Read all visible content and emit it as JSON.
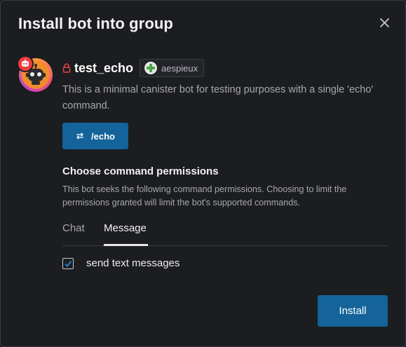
{
  "dialog": {
    "title": "Install bot into group",
    "close_icon": "close-icon"
  },
  "bot": {
    "name": "test_echo",
    "owner": "aespieux",
    "description": "This is a minimal canister bot for testing purposes with a single 'echo' command.",
    "command": "/echo",
    "avatar_icon": "robot-avatar-icon",
    "badge_icon": "bot-badge-icon",
    "lock_icon": "lock-icon",
    "command_icon": "swap-arrows-icon"
  },
  "permissions": {
    "title": "Choose command permissions",
    "description": "This bot seeks the following command permissions. Choosing to limit the permissions granted will limit the bot's supported commands.",
    "tabs": [
      {
        "label": "Chat",
        "active": false
      },
      {
        "label": "Message",
        "active": true
      }
    ],
    "items": [
      {
        "label": "send text messages",
        "checked": true
      }
    ]
  },
  "footer": {
    "install_label": "Install"
  },
  "colors": {
    "background": "#1c1d20",
    "primary_button": "#14639a",
    "lock": "#e04545",
    "checkmark": "#1f7fd6"
  }
}
